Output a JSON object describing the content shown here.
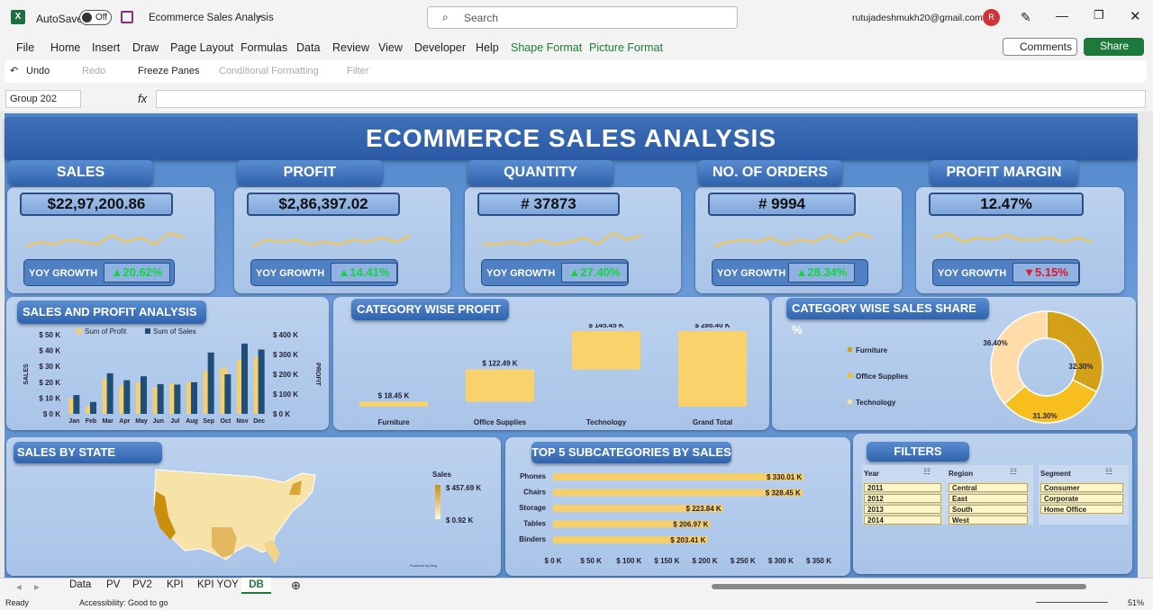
{
  "app": {
    "autosave_label": "AutoSave",
    "autosave_state": "Off",
    "file_title": "Ecommerce Sales Analysis",
    "search_placeholder": "Search",
    "user_email": "rutujadeshmukh20@gmail.com",
    "user_initial": "R"
  },
  "menu": {
    "items": [
      "File",
      "Home",
      "Insert",
      "Draw",
      "Page Layout",
      "Formulas",
      "Data",
      "Review",
      "View",
      "Developer",
      "Help",
      "Shape Format",
      "Picture Format"
    ],
    "comments": "Comments",
    "share": "Share"
  },
  "qat": {
    "undo": "Undo",
    "redo": "Redo",
    "freeze": "Freeze Panes",
    "cond": "Conditional Formatting",
    "filter": "Filter"
  },
  "formula": {
    "namebox": "Group 202",
    "fx": "fx"
  },
  "dashboard": {
    "title": "ECOMMERCE  SALES  ANALYSIS",
    "kpis": [
      {
        "label": "SALES",
        "value": "$22,97,200.86",
        "yoy_label": "YOY GROWTH",
        "yoy": "▲20.62%",
        "up": true
      },
      {
        "label": "PROFIT",
        "value": "$2,86,397.02",
        "yoy_label": "YOY GROWTH",
        "yoy": "▲14.41%",
        "up": true
      },
      {
        "label": "QUANTITY",
        "value": "# 37873",
        "yoy_label": "YOY GROWTH",
        "yoy": "▲27.40%",
        "up": true
      },
      {
        "label": "NO. OF ORDERS",
        "value": "# 9994",
        "yoy_label": "YOY GROWTH",
        "yoy": "▲28.34%",
        "up": true
      },
      {
        "label": "PROFIT MARGIN",
        "value": "12.47%",
        "yoy_label": "YOY GROWTH",
        "yoy": "▼5.15%",
        "up": false
      }
    ],
    "sparklines": [
      [
        6,
        5,
        5.5,
        4.5,
        5,
        5.5,
        3.5,
        5,
        4,
        5.5,
        3,
        4
      ],
      [
        6,
        4.5,
        5,
        4.5,
        5.5,
        5,
        5.5,
        4.5,
        5,
        4,
        5,
        3.5
      ],
      [
        5.5,
        5.5,
        5,
        5.5,
        4.5,
        5.5,
        5,
        4,
        5.5,
        3,
        4.5,
        3.5
      ],
      [
        6,
        5,
        4.5,
        5,
        4,
        5.5,
        4.5,
        5,
        3.5,
        5,
        3,
        4
      ],
      [
        4,
        3,
        5,
        4,
        4.5,
        3.5,
        4.5,
        4.5,
        4,
        5,
        4,
        5
      ]
    ],
    "spa_title": "SALES AND PROFIT ANALYSIS",
    "cwp_title": "CATEGORY WISE PROFIT",
    "cws_title": "CATEGORY WISE SALES SHARE %",
    "sbs_title": "SALES BY STATE",
    "top5_title": "TOP 5 SUBCATEGORIES BY SALES",
    "filters_title": "FILTERS",
    "map_legend_title": "Sales",
    "map_max": "$ 457.69 K",
    "map_min": "$ 0.92 K",
    "map_credit": "Powered by Bing"
  },
  "chart_data": [
    {
      "type": "bar",
      "title": "SALES AND PROFIT ANALYSIS",
      "categories": [
        "Jan",
        "Feb",
        "Mar",
        "Apr",
        "May",
        "Jun",
        "Jul",
        "Aug",
        "Sep",
        "Oct",
        "Nov",
        "Dec"
      ],
      "series": [
        {
          "name": "Sum of Profit",
          "axis": "left",
          "values": [
            10,
            5,
            22,
            18,
            20,
            17,
            19,
            20,
            27,
            29,
            34,
            36
          ]
        },
        {
          "name": "Sum of Sales",
          "axis": "right",
          "values": [
            95,
            60,
            205,
            170,
            190,
            150,
            148,
            160,
            310,
            200,
            355,
            325
          ]
        }
      ],
      "y_left": {
        "label": "SALES",
        "ticks": [
          "$ 0 K",
          "$ 10 K",
          "$ 20 K",
          "$ 30 K",
          "$ 40 K",
          "$ 50 K"
        ],
        "lim": [
          0,
          50
        ]
      },
      "y_right": {
        "label": "PROFIT",
        "ticks": [
          "$ 0 K",
          "$ 100 K",
          "$ 200 K",
          "$ 300 K",
          "$ 400 K"
        ],
        "lim": [
          0,
          400
        ]
      },
      "colors": {
        "Sum of Profit": "#f5d06a",
        "Sum of Sales": "#1f4e79"
      }
    },
    {
      "type": "bar",
      "title": "CATEGORY WISE PROFIT",
      "categories": [
        "Furniture",
        "Office Supplies",
        "Technology",
        "Grand Total"
      ],
      "values": [
        18.45,
        122.49,
        145.45,
        286.4
      ],
      "labels": [
        "$ 18.45 K",
        "$ 122.49 K",
        "$ 145.45 K",
        "$ 286.40 K"
      ],
      "waterfall": true,
      "color": "#f9d26b"
    },
    {
      "type": "pie",
      "title": "CATEGORY WISE SALES SHARE %",
      "categories": [
        "Furniture",
        "Office Supplies",
        "Technology"
      ],
      "values": [
        32.3,
        31.3,
        36.4
      ],
      "labels": [
        "32.30%",
        "31.30%",
        "36.40%"
      ],
      "colors": [
        "#d4a017",
        "#f7bf1e",
        "#ffdca8"
      ]
    },
    {
      "type": "bar",
      "title": "TOP 5 SUBCATEGORIES BY SALES",
      "orientation": "horizontal",
      "categories": [
        "Phones",
        "Chairs",
        "Storage",
        "Tables",
        "Binders"
      ],
      "values": [
        330.01,
        328.45,
        223.84,
        206.97,
        203.41
      ],
      "labels": [
        "$ 330.01 K",
        "$ 328.45 K",
        "$ 223.84 K",
        "$ 206.97 K",
        "$ 203.41 K"
      ],
      "xticks": [
        "$ 0 K",
        "$ 50 K",
        "$ 100 K",
        "$ 150 K",
        "$ 200 K",
        "$ 250 K",
        "$ 300 K",
        "$ 350 K"
      ],
      "xlim": [
        0,
        350
      ],
      "color": "#f7cf6a"
    }
  ],
  "filters": {
    "year": {
      "label": "Year",
      "items": [
        "2011",
        "2012",
        "2013",
        "2014"
      ]
    },
    "region": {
      "label": "Region",
      "items": [
        "Central",
        "East",
        "South",
        "West"
      ]
    },
    "segment": {
      "label": "Segment",
      "items": [
        "Consumer",
        "Corporate",
        "Home Office"
      ]
    }
  },
  "sheets": {
    "tabs": [
      "Data",
      "PV",
      "PV2",
      "KPI",
      "KPI YOY",
      "DB"
    ],
    "active": "DB"
  },
  "status": {
    "ready": "Ready",
    "accessibility": "Accessibility: Good to go",
    "zoom": "51%"
  }
}
